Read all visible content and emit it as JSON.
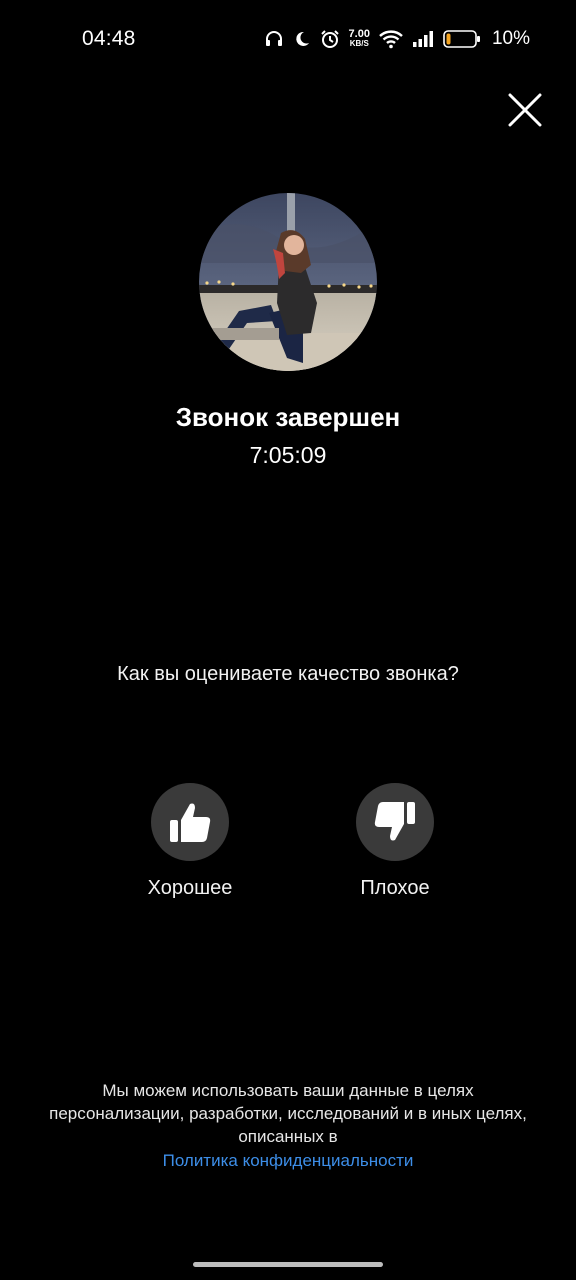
{
  "status_bar": {
    "time": "04:48",
    "net_speed_value": "7.00",
    "net_speed_unit": "KB/S",
    "battery_percent": "10%",
    "icons": [
      "headphones-icon",
      "moon-icon",
      "alarm-icon",
      "wifi-icon",
      "signal-icon",
      "battery-icon"
    ],
    "battery_level": 0.1,
    "battery_color": "#f5a623"
  },
  "close_icon": "close-icon",
  "call": {
    "title": "Звонок завершен",
    "duration": "7:05:09"
  },
  "rating": {
    "question": "Как вы оцениваете качество звонка?",
    "good_label": "Хорошее",
    "bad_label": "Плохое",
    "good_icon": "thumbs-up-icon",
    "bad_icon": "thumbs-down-icon"
  },
  "footer": {
    "disclaimer": "Мы можем использовать ваши данные в целях персонализации, разработки, исследований и в иных целях, описанных в",
    "privacy_link": "Политика конфиденциальности",
    "link_color": "#3d8ee8"
  }
}
